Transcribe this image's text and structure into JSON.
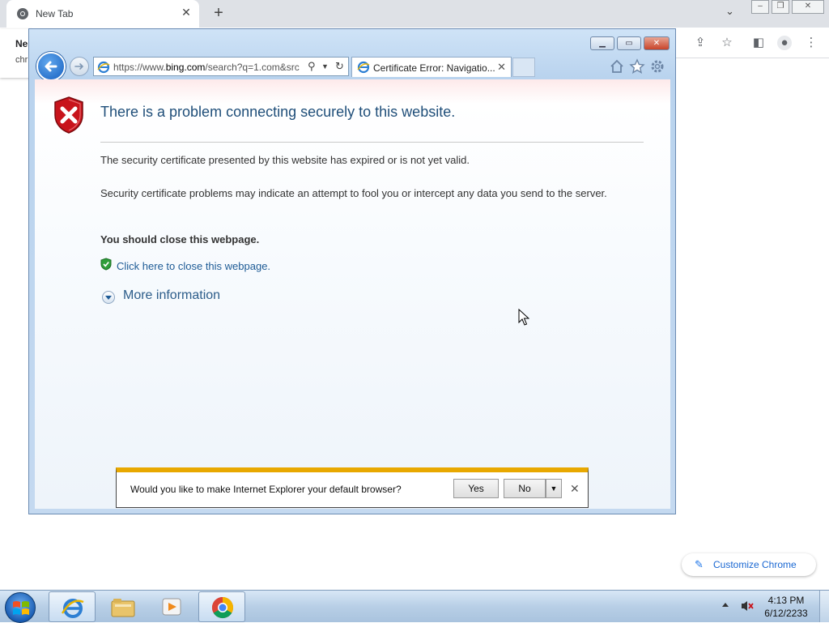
{
  "chrome": {
    "tab_title": "New Tab",
    "behind_heading": "Ne",
    "behind_sub": "chr",
    "customize_label": "Customize Chrome"
  },
  "ie": {
    "address_prefix": "https://www.",
    "address_domain": "bing.com",
    "address_rest": "/search?q=1.com&src",
    "tab_title": "Certificate Error: Navigatio...",
    "error_title": "There is a problem connecting securely to this website.",
    "para1": "The security certificate presented by this website has expired or is not yet valid.",
    "para2": "Security certificate problems may indicate an attempt to fool you or intercept any data you send to the server.",
    "advice": "You should close this webpage.",
    "close_link": "Click here to close this webpage.",
    "more_info": "More information"
  },
  "notification": {
    "message": "Would you like to make Internet Explorer your default browser?",
    "yes": "Yes",
    "no": "No"
  },
  "taskbar": {
    "time": "4:13 PM",
    "date": "6/12/2233"
  },
  "colors": {
    "ie_title_text": "#1f4e79",
    "link": "#1e5b96",
    "notification_bar": "#e8a800",
    "error_shield": "#c8141c"
  }
}
